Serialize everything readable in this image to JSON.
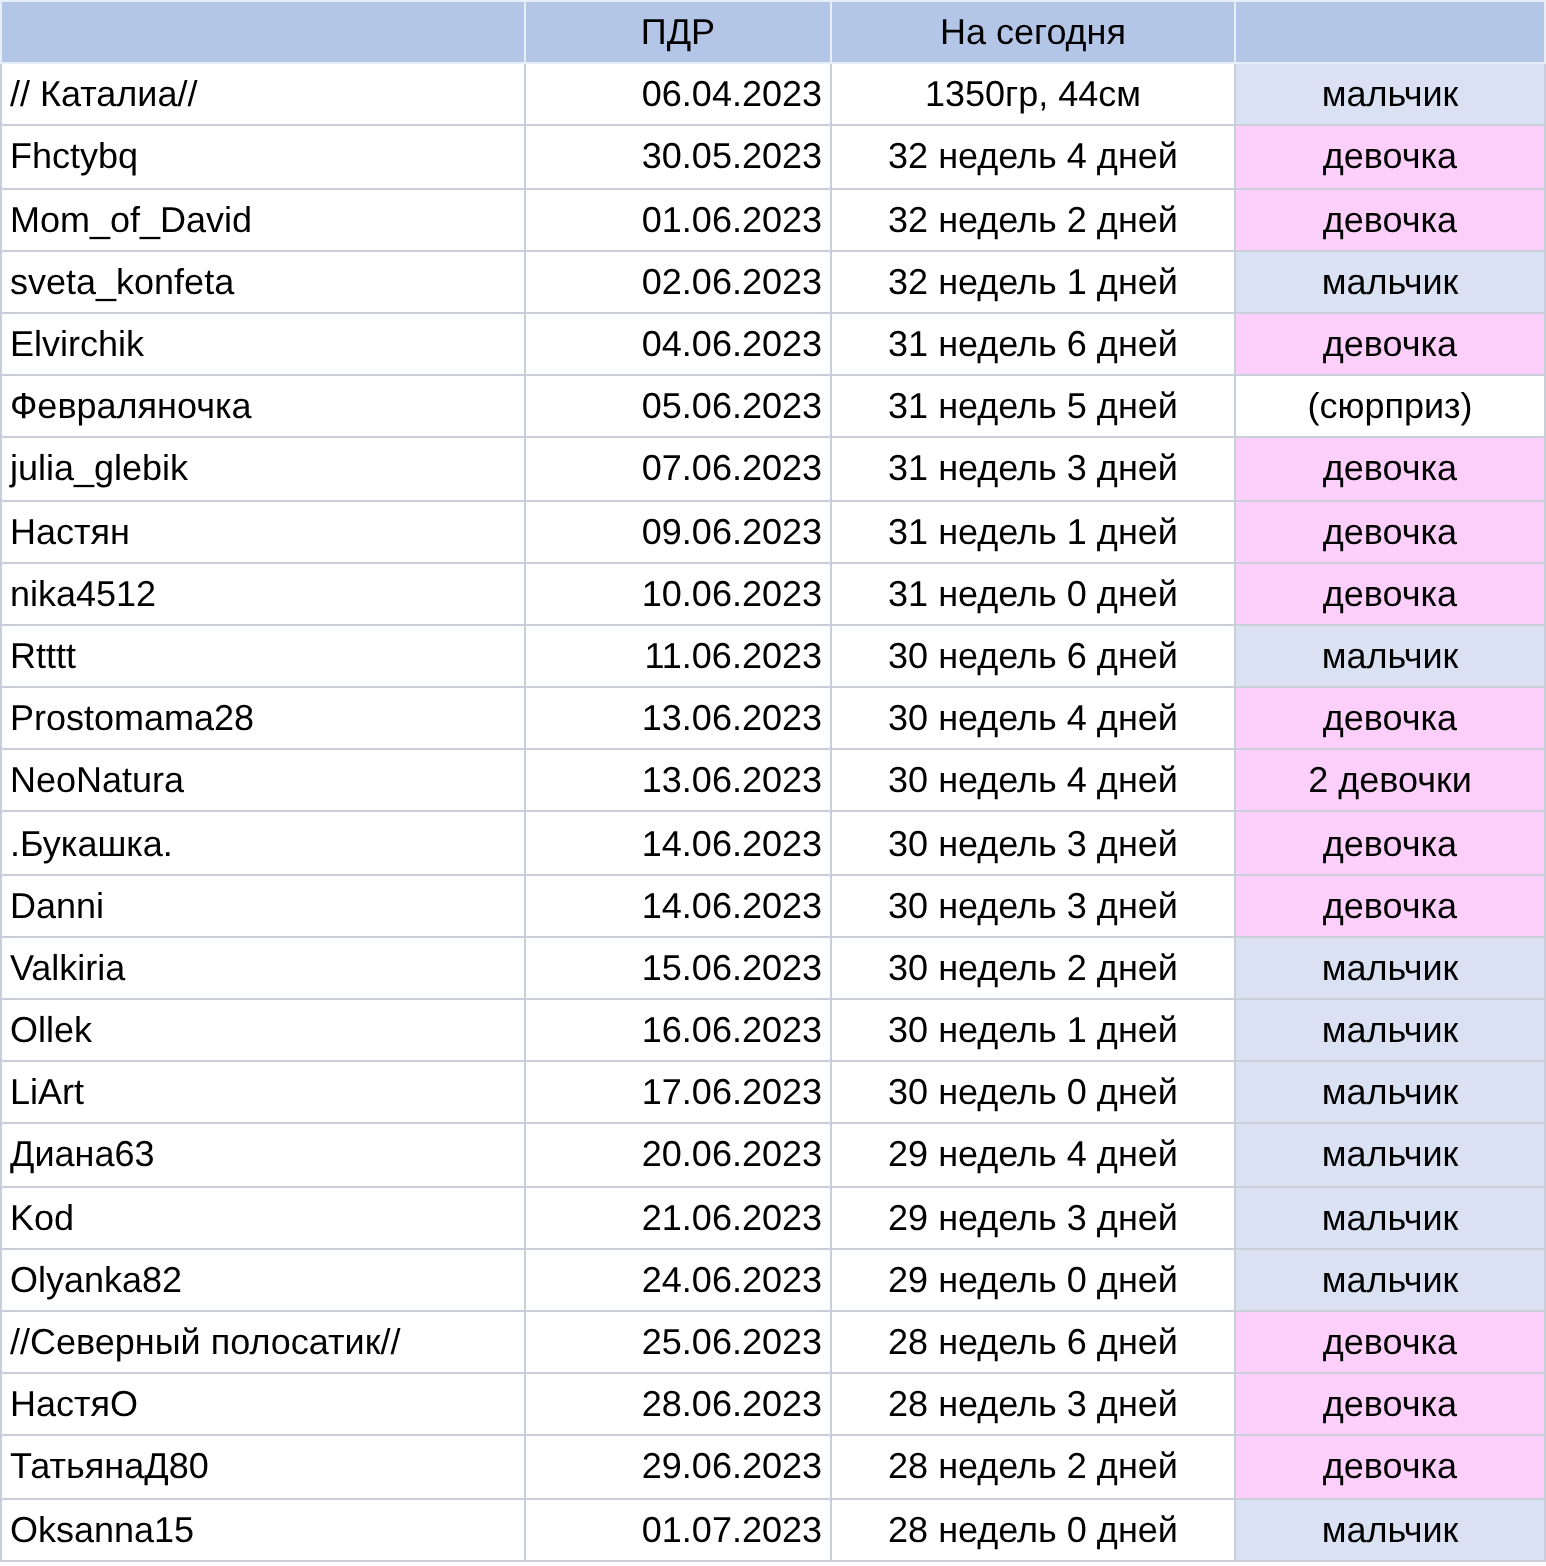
{
  "table": {
    "columns": [
      {},
      {
        "label": "ПДР"
      },
      {
        "label": "На сегодня"
      },
      {}
    ],
    "rows": [
      {
        "name": "// Каталиа//",
        "date": "06.04.2023",
        "today": "1350гр, 44см",
        "baby": "мальчик",
        "color": "#d9e1f2"
      },
      {
        "name": "Fhctybq",
        "date": "30.05.2023",
        "today": "32 недель 4 дней",
        "baby": "девочка",
        "color": "#fccffb"
      },
      {
        "name": "Mom_of_David",
        "date": "01.06.2023",
        "today": "32 недель 2 дней",
        "baby": "девочка",
        "color": "#fccffb"
      },
      {
        "name": "sveta_konfeta",
        "date": "02.06.2023",
        "today": "32 недель 1 дней",
        "baby": "мальчик",
        "color": "#d9e1f2"
      },
      {
        "name": "Elvirchik",
        "date": "04.06.2023",
        "today": "31 недель 6 дней",
        "baby": "девочка",
        "color": "#fccffb"
      },
      {
        "name": "Февраляночка",
        "date": "05.06.2023",
        "today": "31 недель 5 дней",
        "baby": "(сюрприз)",
        "color": "#ffffff"
      },
      {
        "name": "julia_glebik",
        "date": "07.06.2023",
        "today": "31 недель 3 дней",
        "baby": "девочка",
        "color": "#fccffb"
      },
      {
        "name": "Настян",
        "date": "09.06.2023",
        "today": "31 недель 1 дней",
        "baby": "девочка",
        "color": "#fccffb"
      },
      {
        "name": "nika4512",
        "date": "10.06.2023",
        "today": "31 недель 0 дней",
        "baby": "девочка",
        "color": "#fccffb"
      },
      {
        "name": "Rtttt",
        "date": "11.06.2023",
        "today": "30 недель 6 дней",
        "baby": "мальчик",
        "color": "#d9e1f2"
      },
      {
        "name": "Prostomama28",
        "date": "13.06.2023",
        "today": "30 недель 4 дней",
        "baby": "девочка",
        "color": "#fccffb"
      },
      {
        "name": "NeoNatura",
        "date": "13.06.2023",
        "today": "30 недель 4 дней",
        "baby": "2 девочки",
        "color": "#fccffb"
      },
      {
        "name": ".Букашка.",
        "date": "14.06.2023",
        "today": "30 недель 3 дней",
        "baby": "девочка",
        "color": "#fccffb"
      },
      {
        "name": "Danni",
        "date": "14.06.2023",
        "today": "30 недель 3 дней",
        "baby": "девочка",
        "color": "#fccffb"
      },
      {
        "name": "Valkiria",
        "date": "15.06.2023",
        "today": "30 недель 2 дней",
        "baby": "мальчик",
        "color": "#d9e1f2"
      },
      {
        "name": "Ollek",
        "date": "16.06.2023",
        "today": "30 недель 1 дней",
        "baby": "мальчик",
        "color": "#d9e1f2"
      },
      {
        "name": "LiArt",
        "date": "17.06.2023",
        "today": "30 недель 0 дней",
        "baby": "мальчик",
        "color": "#d9e1f2"
      },
      {
        "name": "Диана63",
        "date": "20.06.2023",
        "today": "29 недель 4 дней",
        "baby": "мальчик",
        "color": "#d9e1f2"
      },
      {
        "name": "Kod",
        "date": "21.06.2023",
        "today": "29 недель 3 дней",
        "baby": "мальчик",
        "color": "#d9e1f2"
      },
      {
        "name": "Olyanka82",
        "date": "24.06.2023",
        "today": "29 недель 0 дней",
        "baby": "мальчик",
        "color": "#d9e1f2"
      },
      {
        "name": "//Северный полосатик//",
        "date": "25.06.2023",
        "today": "28 недель 6 дней",
        "baby": "девочка",
        "color": "#fccffb"
      },
      {
        "name": "НастяО",
        "date": "28.06.2023",
        "today": "28 недель 3 дней",
        "baby": "девочка",
        "color": "#fccffb"
      },
      {
        "name": "ТатьянаД80",
        "date": "29.06.2023",
        "today": "28 недель 2 дней",
        "baby": "девочка",
        "color": "#fccffb"
      },
      {
        "name": "Oksanna15",
        "date": "01.07.2023",
        "today": "28 недель 0 дней",
        "baby": "мальчик",
        "color": "#d9e1f2"
      }
    ]
  }
}
